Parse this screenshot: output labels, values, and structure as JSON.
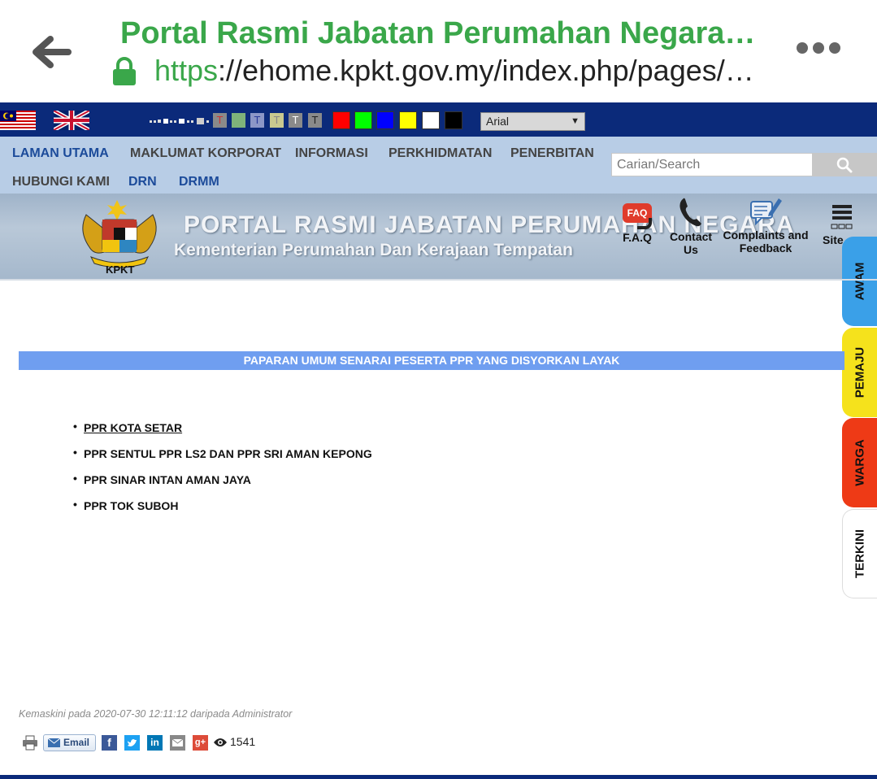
{
  "browser": {
    "title": "Portal Rasmi Jabatan Perumahan Negara…",
    "url_scheme": "https",
    "url_rest": "://ehome.kpkt.gov.my/index.php/pages/…",
    "icons": [
      "back-arrow-icon",
      "lock-icon",
      "more-icon"
    ]
  },
  "accessibility": {
    "tool_letters": [
      "T",
      "T",
      "T",
      "T",
      "T",
      "T"
    ],
    "tool_colors": [
      "#8a8a8a",
      "#7fb37a",
      "#8c97c7",
      "#c9c98f",
      "#8a8a8a",
      "#8a8a8a"
    ],
    "swatches": [
      "#ff0000",
      "#00ff00",
      "#0000ff",
      "#ffff00",
      "#ffffff",
      "#000000"
    ],
    "font_select": "Arial"
  },
  "nav": {
    "items": [
      "LAMAN UTAMA",
      "MAKLUMAT KORPORAT",
      "INFORMASI",
      "PERKHIDMATAN",
      "PENERBITAN",
      "HUBUNGI KAMI",
      "DRN",
      "DRMM"
    ],
    "search_placeholder": "Carian/Search"
  },
  "banner": {
    "title": "PORTAL RASMI JABATAN PERUMAHAN NEGARA",
    "subtitle": "Kementerian Perumahan Dan Kerajaan Tempatan",
    "logo_label": "KPKT",
    "faq_badge": "FAQ",
    "faq_label": "F.A.Q",
    "contact_label_1": "Contact",
    "contact_label_2": "Us",
    "feedback_label_1": "Complaints and",
    "feedback_label_2": "Feedback",
    "sitemap_label": "Site"
  },
  "side_tabs": [
    {
      "label": "AWAM",
      "color": "#3aa0e8"
    },
    {
      "label": "PEMAJU",
      "color": "#f5e21c"
    },
    {
      "label": "WARGA",
      "color": "#ee3a16"
    },
    {
      "label": "TERKINI",
      "color": "#ffffff"
    }
  ],
  "content": {
    "heading": "PAPARAN UMUM SENARAI PESERTA PPR YANG DISYORKAN LAYAK",
    "items": [
      "PPR KOTA SETAR",
      "PPR SENTUL PPR LS2 DAN PPR SRI AMAN KEPONG",
      "PPR SINAR INTAN AMAN JAYA",
      "PPR TOK SUBOH"
    ],
    "updated": "Kemaskini pada 2020-07-30 12:11:12 daripada Administrator",
    "email_label": "Email",
    "views": "1541"
  }
}
